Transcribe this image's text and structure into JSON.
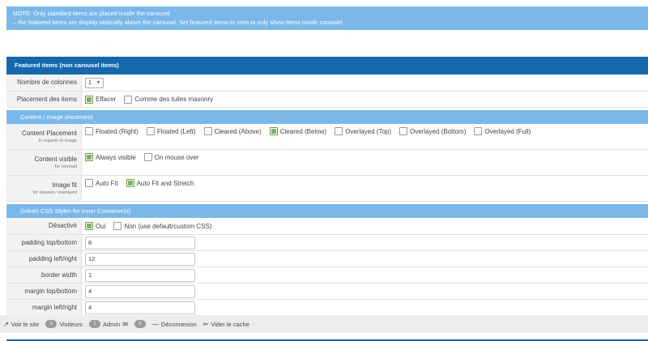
{
  "note": {
    "line1": "NOTE: Only standard items are placed inside the carousel",
    "line2": "– the featured items are display statically above the carousel. Set featured items to zero to only show items inside carousel"
  },
  "featured": {
    "title": "Featured items (non carousel items)",
    "columns_label": "Nombre de colonnes",
    "columns_value": "1",
    "placement_label": "Placement des items",
    "placement_options": [
      "Effacer",
      "Comme des tuiles masonry"
    ]
  },
  "content": {
    "title": "Content / image placement",
    "placement_label": "Content Placement",
    "placement_sub": "in regards to image",
    "placement_options": [
      "Floated (Right)",
      "Floated (Left)",
      "Cleared (Above)",
      "Cleared (Below)",
      "Overlayed (Top)",
      "Overlayed (Bottom)",
      "Overlayed (Full)"
    ],
    "visible_label": "Content visible",
    "visible_sub": "for overlaid",
    "visible_options": [
      "Always visible",
      "On mouse over"
    ],
    "fit_label": "Image fit",
    "fit_sub": "for cleared / overlayed",
    "fit_options": [
      "Auto Fit",
      "Auto Fit and Stretch"
    ]
  },
  "styles": {
    "title": "(Inline) CSS Styles for Inner Container(s)",
    "disabled_label": "Désactivé",
    "disabled_options": [
      "Oui",
      "Non (use default/custom CSS)"
    ],
    "fields": [
      {
        "label": "padding top/bottom",
        "value": "8"
      },
      {
        "label": "padding left/right",
        "value": "12"
      },
      {
        "label": "border width",
        "value": "1"
      },
      {
        "label": "margin top/bottom",
        "value": "4"
      },
      {
        "label": "margin left/right",
        "value": "4"
      }
    ]
  },
  "adminbar": {
    "view_site": "Voir le site",
    "visitors_count": "0",
    "visitors_label": "Visiteurs",
    "admin_count": "1",
    "admin_label": "Admin",
    "messages_count": "0",
    "logout": "Déconnexion",
    "clear_cache": "Vider le cache"
  }
}
